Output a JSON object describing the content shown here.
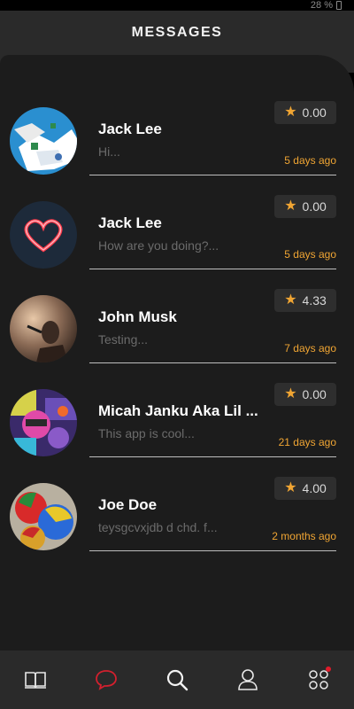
{
  "status": {
    "battery": "28 %"
  },
  "header": {
    "title": "MESSAGES"
  },
  "messages": [
    {
      "name": "Jack Lee",
      "preview": "Hi...",
      "rating": "0.00",
      "time": "5 days ago"
    },
    {
      "name": "Jack Lee",
      "preview": "How are you doing?...",
      "rating": "0.00",
      "time": "5 days ago"
    },
    {
      "name": "John Musk",
      "preview": "Testing...",
      "rating": "4.33",
      "time": "7 days ago"
    },
    {
      "name": "Micah Janku Aka Lil ...",
      "preview": "This app is cool...",
      "rating": "0.00",
      "time": "21 days ago"
    },
    {
      "name": "Joe Doe",
      "preview": "teysgcvxjdb d chd. f...",
      "rating": "4.00",
      "time": "2 months ago"
    }
  ],
  "nav": {
    "items": [
      {
        "icon": "book-icon"
      },
      {
        "icon": "chat-bubble-icon",
        "active": true
      },
      {
        "icon": "search-icon"
      },
      {
        "icon": "user-icon"
      },
      {
        "icon": "apps-grid-icon",
        "notification": true
      }
    ]
  },
  "colors": {
    "accent": "#f0a533",
    "active_nav": "#d3202e",
    "background": "#1c1c1c",
    "header": "#2a2a2a"
  }
}
